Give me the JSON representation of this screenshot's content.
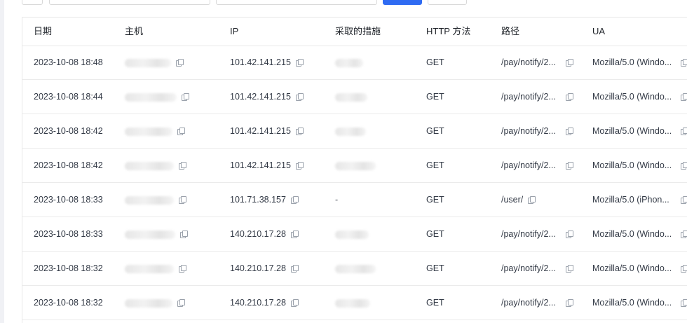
{
  "table": {
    "columns": [
      "日期",
      "主机",
      "IP",
      "采取的措施",
      "HTTP 方法",
      "路径",
      "UA"
    ],
    "rows": [
      {
        "date": "2023-10-08 18:48",
        "ip": "101.42.141.215",
        "action": "",
        "method": "GET",
        "path": "/pay/notify/2...",
        "ua": "Mozilla/5.0 (Windo..."
      },
      {
        "date": "2023-10-08 18:44",
        "ip": "101.42.141.215",
        "action": "",
        "method": "GET",
        "path": "/pay/notify/2...",
        "ua": "Mozilla/5.0 (Windo..."
      },
      {
        "date": "2023-10-08 18:42",
        "ip": "101.42.141.215",
        "action": "",
        "method": "GET",
        "path": "/pay/notify/2...",
        "ua": "Mozilla/5.0 (Windo..."
      },
      {
        "date": "2023-10-08 18:42",
        "ip": "101.42.141.215",
        "action": "",
        "method": "GET",
        "path": "/pay/notify/2...",
        "ua": "Mozilla/5.0 (Windo..."
      },
      {
        "date": "2023-10-08 18:33",
        "ip": "101.71.38.157",
        "action": "-",
        "method": "GET",
        "path": "/user/",
        "ua": "Mozilla/5.0 (iPhon..."
      },
      {
        "date": "2023-10-08 18:33",
        "ip": "140.210.17.28",
        "action": "",
        "method": "GET",
        "path": "/pay/notify/2...",
        "ua": "Mozilla/5.0 (Windo..."
      },
      {
        "date": "2023-10-08 18:32",
        "ip": "140.210.17.28",
        "action": "",
        "method": "GET",
        "path": "/pay/notify/2...",
        "ua": "Mozilla/5.0 (Windo..."
      },
      {
        "date": "2023-10-08 18:32",
        "ip": "140.210.17.28",
        "action": "",
        "method": "GET",
        "path": "/pay/notify/2...",
        "ua": "Mozilla/5.0 (Windo..."
      }
    ]
  },
  "colors": {
    "primary": "#2f6bf2",
    "border": "#e8e8e8",
    "text": "#333a46"
  },
  "icons": {
    "copy": "copy-icon"
  }
}
